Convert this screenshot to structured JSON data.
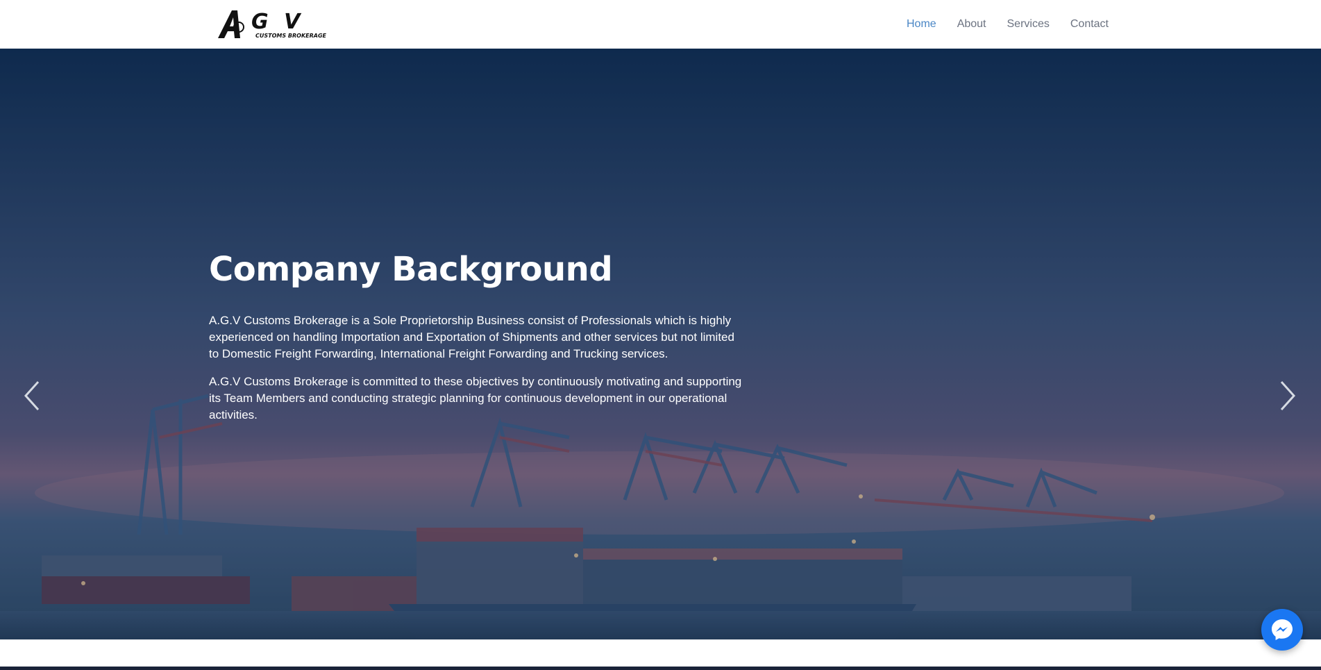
{
  "brand": {
    "logo_text": "AGV",
    "logo_subtext": "CUSTOMS BROKERAGE"
  },
  "nav": {
    "items": [
      {
        "label": "Home",
        "active": true
      },
      {
        "label": "About",
        "active": false
      },
      {
        "label": "Services",
        "active": false
      },
      {
        "label": "Contact",
        "active": false
      }
    ]
  },
  "hero": {
    "title": "Company Background",
    "paragraphs": [
      "A.G.V Customs Brokerage is a Sole Proprietorship Business consist of Professionals which is highly experienced on handling Importation and Exportation of Shipments and other services but not limited to Domestic Freight Forwarding, International Freight Forwarding and Trucking services.",
      "A.G.V Customs Brokerage is committed to these objectives by continuously motivating and supporting its Team Members and conducting strategic planning for continuous development in our operational activities."
    ]
  },
  "carousel": {
    "slide_count": 5,
    "active_index": 1
  },
  "icons": {
    "prev": "chevron-left-icon",
    "next": "chevron-right-icon",
    "chat": "messenger-icon"
  },
  "colors": {
    "nav_active": "#4a86c5",
    "nav_text": "#6b7280",
    "messenger": "#1a77f2"
  }
}
